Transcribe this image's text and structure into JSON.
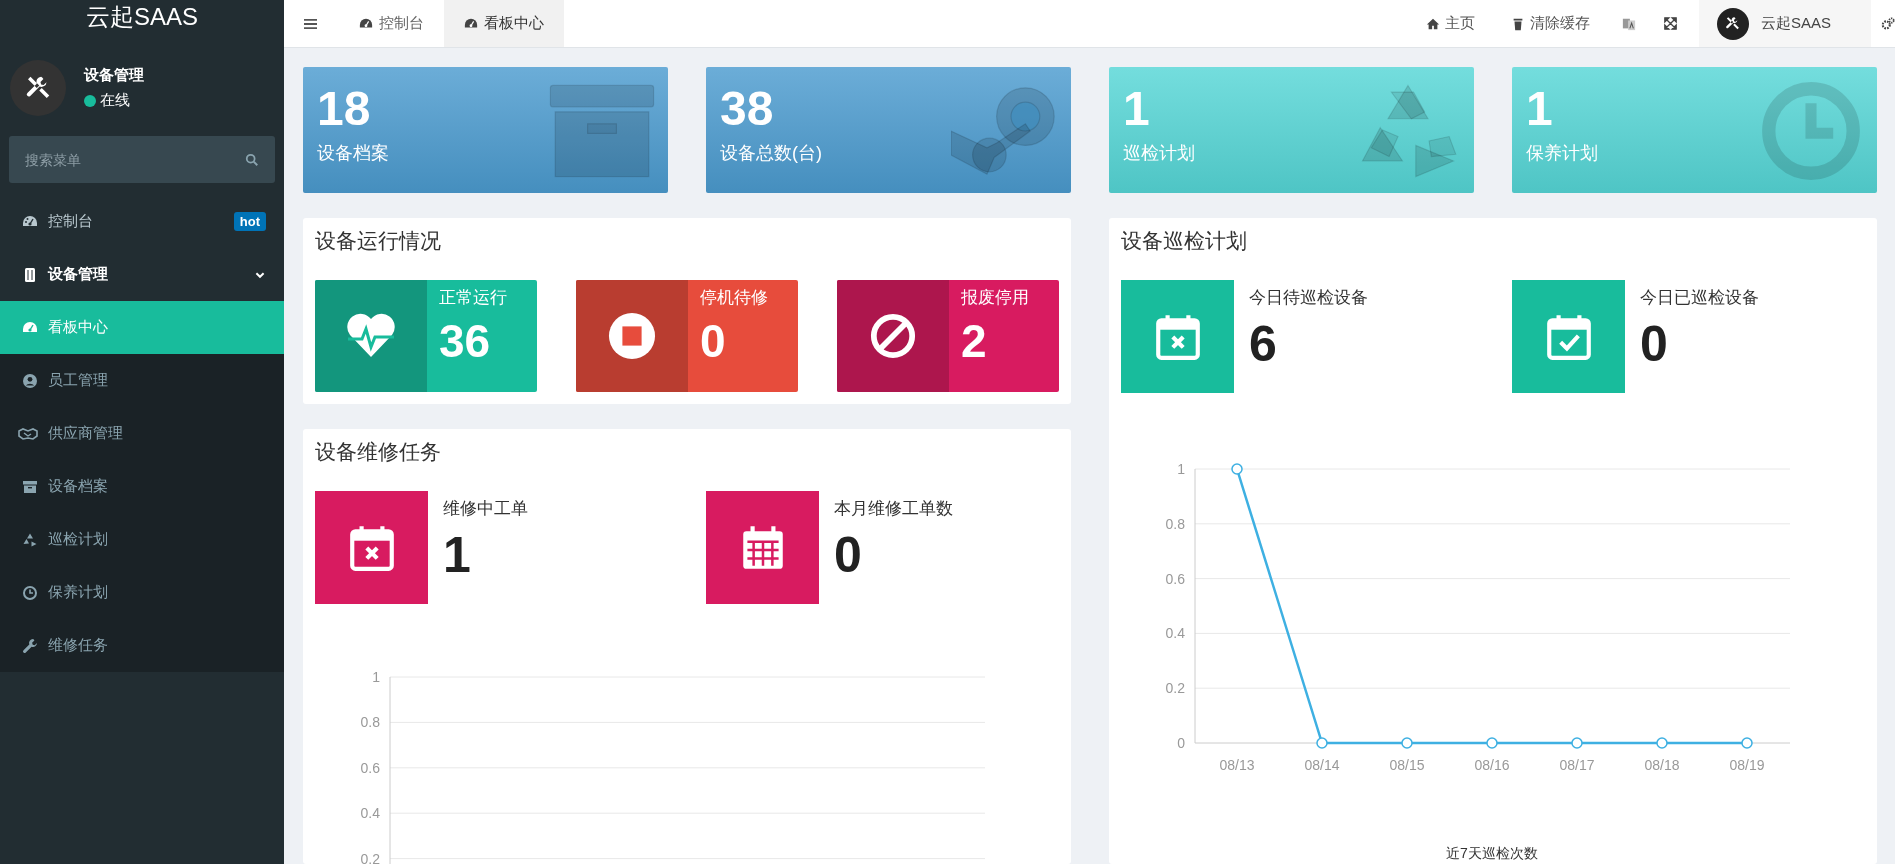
{
  "sidebar": {
    "logo": "云起SAAS",
    "user": {
      "name": "设备管理",
      "status": "在线",
      "online": true
    },
    "search": {
      "placeholder": "搜索菜单"
    },
    "menu": [
      {
        "label": "控制台",
        "badge": "hot",
        "selected": false
      },
      {
        "label": "设备管理",
        "selected": false,
        "expanded": true,
        "children": [
          {
            "label": "看板中心",
            "selected": true
          },
          {
            "label": "员工管理",
            "selected": false
          },
          {
            "label": "供应商管理",
            "selected": false
          },
          {
            "label": "设备档案",
            "selected": false
          },
          {
            "label": "巡检计划",
            "selected": false
          },
          {
            "label": "保养计划",
            "selected": false
          },
          {
            "label": "维修任务",
            "selected": false
          }
        ]
      }
    ]
  },
  "topbar": {
    "tabs": [
      {
        "label": "控制台",
        "selected": false
      },
      {
        "label": "看板中心",
        "selected": true
      }
    ],
    "links": [
      {
        "label": "主页"
      },
      {
        "label": "清除缓存"
      }
    ],
    "user": {
      "name": "云起SAAS"
    }
  },
  "stat_cards": [
    {
      "value": "18",
      "label": "设备档案",
      "color": "#4b9bcf"
    },
    {
      "value": "38",
      "label": "设备总数(台)",
      "color": "#4b9bcf"
    },
    {
      "value": "1",
      "label": "巡检计划",
      "color": "#55d6d6"
    },
    {
      "value": "1",
      "label": "保养计划",
      "color": "#55d6d6"
    }
  ],
  "running_panel": {
    "title": "设备运行情况",
    "items": [
      {
        "label": "正常运行",
        "value": "36",
        "color": "#18bc9c"
      },
      {
        "label": "停机待修",
        "value": "0",
        "color": "#e74c3c"
      },
      {
        "label": "报废停用",
        "value": "2",
        "color": "#d81b60"
      }
    ]
  },
  "maintenance_panel": {
    "title": "设备维修任务",
    "items": [
      {
        "label": "维修中工单",
        "value": "1"
      },
      {
        "label": "本月维修工单数",
        "value": "0"
      }
    ],
    "chart": {
      "y_axis_labels": [
        "1",
        "0.8",
        "0.6",
        "0.4",
        "0.2"
      ]
    }
  },
  "inspection_panel": {
    "title": "设备巡检计划",
    "items": [
      {
        "label": "今日待巡检设备",
        "value": "6"
      },
      {
        "label": "今日已巡检设备",
        "value": "0"
      }
    ],
    "chart_data": {
      "type": "line",
      "title": "近7天巡检次数",
      "categories": [
        "08/13",
        "08/14",
        "08/15",
        "08/16",
        "08/17",
        "08/18",
        "08/19"
      ],
      "series": [
        {
          "color": "#3eb0e2",
          "marker": "circle",
          "values": [
            1,
            0,
            0,
            0,
            0,
            0,
            0
          ]
        }
      ],
      "grid": true,
      "ylim": [
        0,
        1
      ],
      "yticks": [
        0,
        0.2,
        0.4,
        0.6,
        0.8,
        1
      ]
    }
  }
}
